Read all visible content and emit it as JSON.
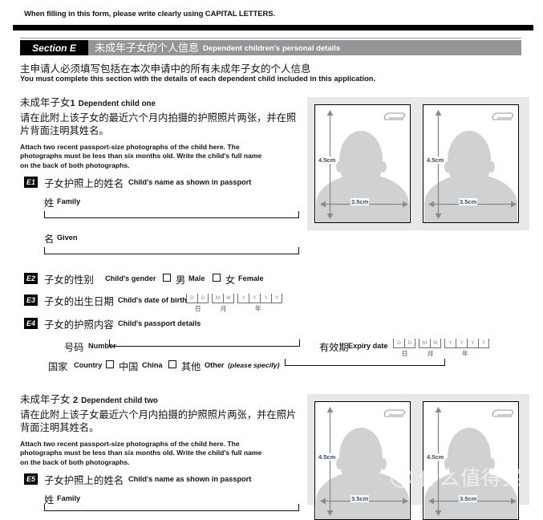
{
  "top_note": "When filling in this form, please write clearly using CAPITAL LETTERS.",
  "section": {
    "tag": "Section E",
    "title_cn": "未成年子女的个人信息",
    "title_en": "Dependent children's personal details",
    "intro_cn": "主申请人必须填写包括在本次申请中的所有未成年子女的个人信息",
    "intro_en": "You must complete this section with the details of each dependent child included in this application.",
    "tag_bg": "#000000",
    "bar_bg": "#939598"
  },
  "children": [
    {
      "title_cn": "未成年子女",
      "title_num": "1",
      "title_en": "Dependent child one",
      "instr_cn": "请在此附上该子女的最近六个月内拍摄的护照照片两张，并在照片背面注明其姓名。",
      "instr_en": "Attach two recent passport-size photographs of the child here. The photographs must be less than six months old. Write the child's full name on the back of both photographs.",
      "q_name": {
        "badge": "E1",
        "cn": "子女护照上的姓名",
        "en": "Child's name as shown in passport",
        "family_cn": "姓",
        "family_en": "Family",
        "given_cn": "名",
        "given_en": "Given"
      },
      "q_gender": {
        "badge": "E2",
        "cn": "子女的性别",
        "en": "Child's gender",
        "male_cn": "男",
        "male_en": "Male",
        "female_cn": "女",
        "female_en": "Female"
      },
      "q_dob": {
        "badge": "E3",
        "cn": "子女的出生日期",
        "en": "Child's date of birth",
        "cells": [
          "D",
          "D",
          "M",
          "M",
          "Y",
          "Y",
          "Y",
          "Y"
        ],
        "under_day": "日",
        "under_month": "月",
        "under_year": "年"
      },
      "q_passport": {
        "badge": "E4",
        "cn": "子女的护照内容",
        "en": "Child's passport details",
        "number_cn": "号码",
        "number_en": "Number",
        "expiry_cn": "有效期",
        "expiry_en": "Expiry date",
        "expiry_cells": [
          "D",
          "D",
          "M",
          "M",
          "Y",
          "Y",
          "Y",
          "Y"
        ],
        "under_day": "日",
        "under_month": "月",
        "under_year": "年",
        "country_cn": "国家",
        "country_en": "Country",
        "china_cn": "中国",
        "china_en": "China",
        "other_cn": "其他",
        "other_en": "Other",
        "other_hint": "(please specify)"
      }
    },
    {
      "title_cn": "未成年子女",
      "title_num": "2",
      "title_en": "Dependent child two",
      "instr_cn": "请在此附上该子女最近六个月内拍摄的护照照片两张，并在照片背面注明其姓名。",
      "instr_en": "Attach two recent passport-size photographs of the child here. The photographs must be less than six months old. Write the child's full name on the back of both photographs.",
      "q_name": {
        "badge": "E5",
        "cn": "子女护照上的姓名",
        "en": "Child's name as shown in passport",
        "family_cn": "姓",
        "family_en": "Family"
      }
    }
  ],
  "photo": {
    "height_label": "4.5cm",
    "width_label": "3.5cm"
  },
  "watermark": {
    "logo_char": "值",
    "text": "什么值得买"
  }
}
